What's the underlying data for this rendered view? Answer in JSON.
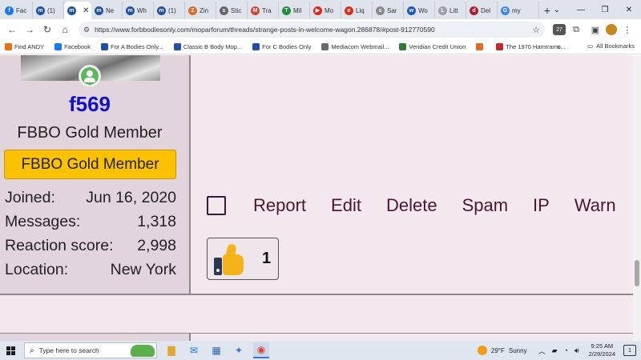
{
  "browser": {
    "tabs": [
      {
        "label": "Fac",
        "color": "#1877f2",
        "glyph": "f"
      },
      {
        "label": "(1)",
        "color": "#1f4fa8",
        "glyph": "m"
      },
      {
        "label": "",
        "color": "#1f4fa8",
        "glyph": "m",
        "active": true
      },
      {
        "label": "Ne",
        "color": "#1f4fa8",
        "glyph": "m"
      },
      {
        "label": "Wh",
        "color": "#1f4fa8",
        "glyph": "m"
      },
      {
        "label": "(1)",
        "color": "#1f4fa8",
        "glyph": "m"
      },
      {
        "label": "Zin",
        "color": "#e06a2a",
        "glyph": "Z"
      },
      {
        "label": "Stic",
        "color": "#666666",
        "glyph": "s"
      },
      {
        "label": "Tra",
        "color": "#d44638",
        "glyph": "M"
      },
      {
        "label": "Mil",
        "color": "#1e8e3e",
        "glyph": "T"
      },
      {
        "label": "Mo",
        "color": "#e62117",
        "glyph": "▶"
      },
      {
        "label": "Liq",
        "color": "#d93025",
        "glyph": "e"
      },
      {
        "label": "Sar",
        "color": "#888888",
        "glyph": "s"
      },
      {
        "label": "Wo",
        "color": "#1a56c4",
        "glyph": "w"
      },
      {
        "label": "Litt",
        "color": "#9aa0a6",
        "glyph": "L"
      },
      {
        "label": "Del",
        "color": "#b01c2e",
        "glyph": "d"
      },
      {
        "label": "my",
        "color": "#4285f4",
        "glyph": "G"
      }
    ],
    "close_tab_glyph": "✕",
    "new_tab_glyph": "+",
    "window_controls": [
      "⌄",
      "—",
      "❐",
      "✕"
    ],
    "url": "https://www.forbbodiesonly.com/moparforum/threads/strange-posts-in-welcome-wagon.286878/#post-912770590",
    "nav": {
      "back": "←",
      "forward": "→",
      "reload": "↻",
      "home": "⌂"
    },
    "toolbar_icons": {
      "site_info": "⚙",
      "bookmark_star": "☆",
      "extension_badge": "27",
      "extensions": "⧉",
      "sidepanel": "▣"
    },
    "bookmarks": [
      {
        "label": "Find ANDY",
        "color": "#e8710a"
      },
      {
        "label": "Facebook",
        "color": "#1877f2"
      },
      {
        "label": "For A Bodies Only...",
        "color": "#1f4fa8"
      },
      {
        "label": "Classic B Body Mop...",
        "color": "#1f4fa8"
      },
      {
        "label": "For C Bodies Only",
        "color": "#1f4fa8"
      },
      {
        "label": "Mediacom Webmail...",
        "color": "#6b6b6b"
      },
      {
        "label": "Veridian Credit Union",
        "color": "#2e7d32"
      },
      {
        "label": "",
        "color": "#e06a2a"
      },
      {
        "label": "The 1970 Hamtramc...",
        "color": "#c62828"
      }
    ],
    "bookmarks_more": "»",
    "all_bookmarks": "All Bookmarks"
  },
  "user": {
    "username": "f569",
    "user_title": "FBBO Gold Member",
    "banner": "FBBO Gold Member",
    "stats": [
      {
        "label": "Joined:",
        "value": "Jun 16, 2020"
      },
      {
        "label": "Messages:",
        "value": "1,318"
      },
      {
        "label": "Reaction score:",
        "value": "2,998"
      },
      {
        "label": "Location:",
        "value": "New York"
      }
    ]
  },
  "post_actions": [
    "Report",
    "Edit",
    "Delete",
    "Spam",
    "IP",
    "Warn"
  ],
  "reaction": {
    "count": "1"
  },
  "taskbar": {
    "search_placeholder": "Type here to search",
    "weather": {
      "temp": "29°F",
      "condition": "Sunny"
    },
    "clock": {
      "time": "9:25 AM",
      "date": "2/29/2024"
    },
    "notifications": "1"
  },
  "colors": {
    "username": "#1111cc",
    "banner_bg": "#fcc200",
    "action_text": "#4a1630",
    "page_bg": "#f3e8ee",
    "panel_bg": "#e2d4dc"
  }
}
